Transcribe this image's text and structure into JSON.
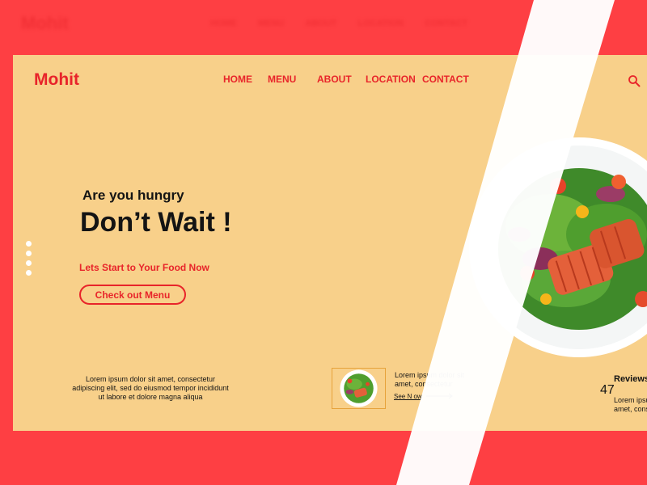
{
  "brand": "Mohit",
  "nav": [
    "HOME",
    "MENU",
    "ABOUT",
    "LOCATION",
    "CONTACT"
  ],
  "hero": {
    "eyebrow": "Are you hungry",
    "headline": "Don’t Wait !",
    "tagline": "Lets Start to Your Food Now",
    "cta": "Check out Menu"
  },
  "description": "Lorem ipsum dolor sit amet, consectetur adipiscing elit, sed do eiusmod tempor incididunt ut labore et dolore magna aliqua",
  "card": {
    "text": "Lorem ipsum dolor sit amet, consectetur",
    "link": "See N ow"
  },
  "reviews": {
    "title": "Reviews",
    "count": "47",
    "text_line1": "Lorem ipsum",
    "text_line2": "amet, consec"
  },
  "icons": [
    "search-icon",
    "arrow-right-icon",
    "salad-plate-image"
  ],
  "colors": {
    "accent": "#e8242a",
    "background": "#fe3f43",
    "panel": "#f8d08a",
    "text": "#141414"
  }
}
